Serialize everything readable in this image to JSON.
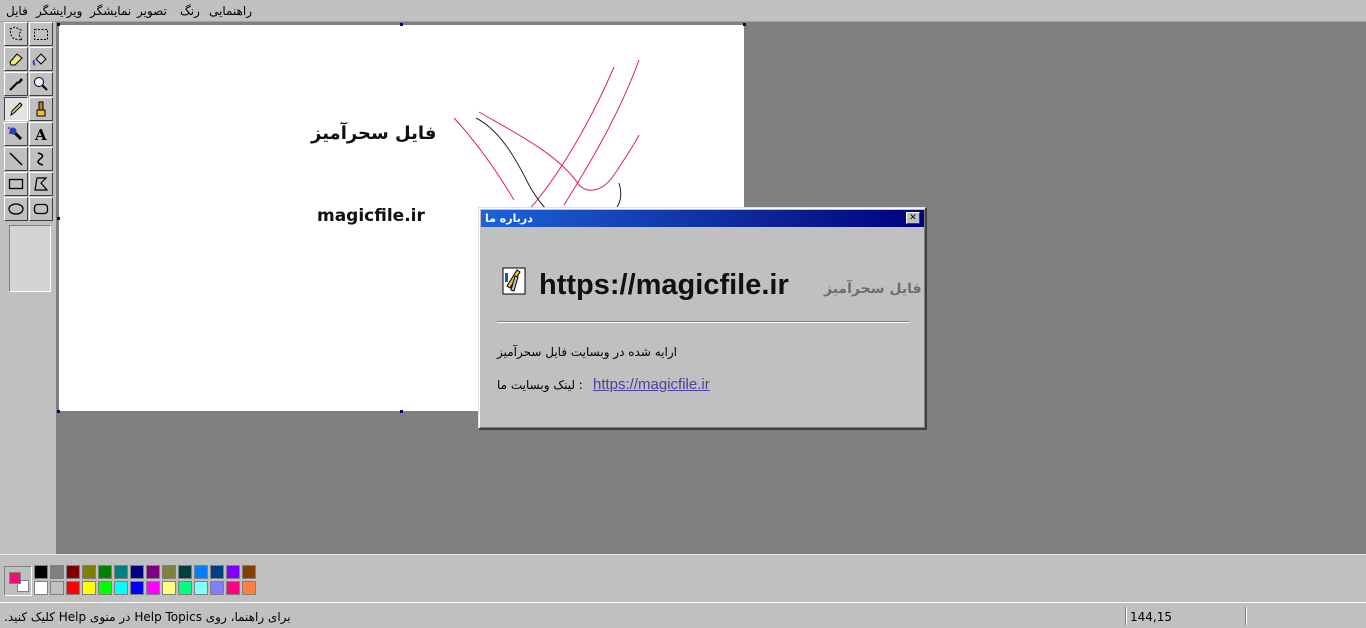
{
  "menu": {
    "items": [
      "فایل",
      "ویرایشگر",
      "نمایشگر",
      "تصویر",
      "رنگ",
      "راهنمایی"
    ]
  },
  "tools": [
    {
      "name": "free-form-select-icon"
    },
    {
      "name": "rect-select-icon"
    },
    {
      "name": "eraser-icon"
    },
    {
      "name": "fill-bucket-icon"
    },
    {
      "name": "color-picker-icon"
    },
    {
      "name": "magnifier-icon"
    },
    {
      "name": "pencil-icon"
    },
    {
      "name": "brush-icon"
    },
    {
      "name": "airbrush-icon"
    },
    {
      "name": "text-icon"
    },
    {
      "name": "line-icon"
    },
    {
      "name": "curve-icon"
    },
    {
      "name": "rectangle-icon"
    },
    {
      "name": "polygon-icon"
    },
    {
      "name": "ellipse-icon"
    },
    {
      "name": "rounded-rect-icon"
    }
  ],
  "canvas": {
    "brand_text": "فایل سحرآمیز",
    "url_text": "magicfile.ir"
  },
  "dialog": {
    "title": "درباره ما",
    "close_glyph": "✕",
    "big_url": "https://magicfile.ir",
    "brand": "فایل سحرآمیز",
    "line1": "ارایه شده در وبسایت فایل سحرآمیز",
    "link_label": "لینک وبسایت ما :",
    "link_url": "https://magicfile.ir"
  },
  "palette": {
    "foreground": "#ee1078",
    "background": "#ffffff",
    "colors_row1": [
      "#000000",
      "#808080",
      "#800000",
      "#808000",
      "#008000",
      "#008080",
      "#000080",
      "#800080",
      "#808040",
      "#004040",
      "#0080ff",
      "#004080",
      "#8000ff",
      "#804000"
    ],
    "colors_row2": [
      "#ffffff",
      "#c0c0c0",
      "#ff0000",
      "#ffff00",
      "#00ff00",
      "#00ffff",
      "#0000ff",
      "#ff00ff",
      "#ffff80",
      "#00ff80",
      "#80ffff",
      "#8080ff",
      "#ff0080",
      "#ff8040"
    ]
  },
  "status": {
    "help_text": "برای راهنما، روی Help Topics در منوی Help کلیک کنید.",
    "coords": "144,15"
  }
}
